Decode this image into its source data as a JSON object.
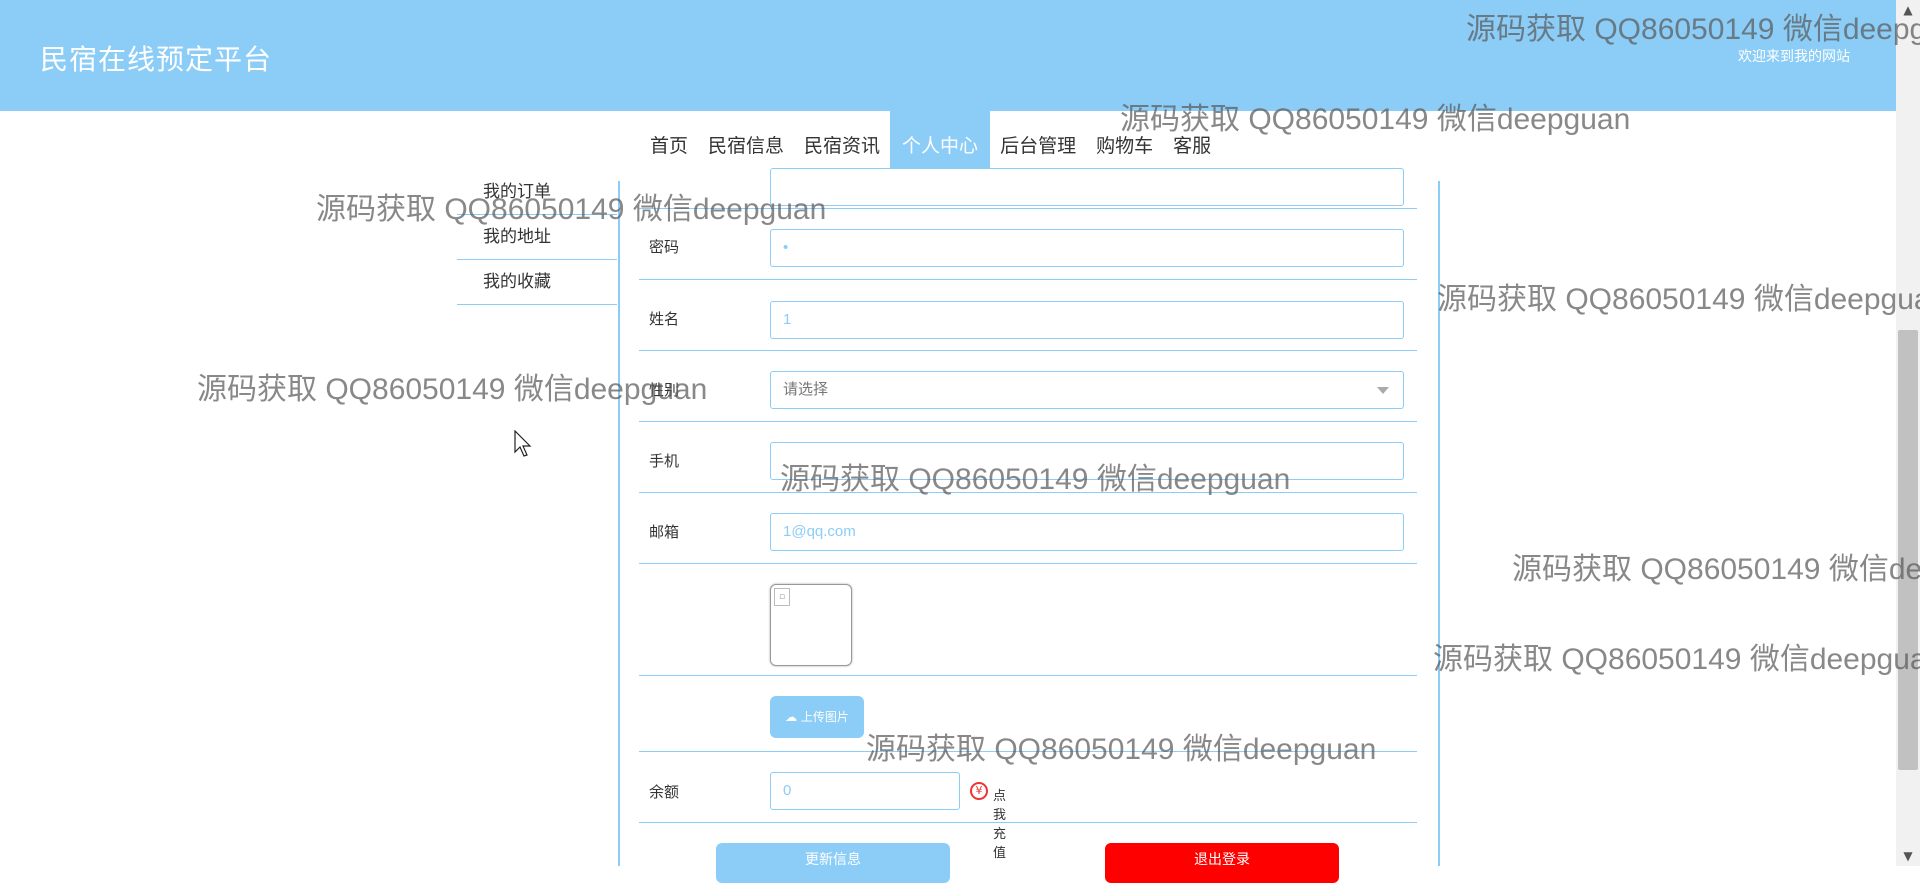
{
  "header": {
    "site_title": "民宿在线预定平台",
    "welcome": "欢迎来到我的网站",
    "bg_color": "#8bcdf7"
  },
  "nav": {
    "items": [
      "首页",
      "民宿信息",
      "民宿资讯",
      "个人中心",
      "后台管理",
      "购物车",
      "客服"
    ],
    "active": "个人中心"
  },
  "side_menu": {
    "items": [
      "我的订单",
      "我的地址",
      "我的收藏"
    ]
  },
  "form": {
    "password_label": "密码",
    "password_value": "•",
    "name_label": "姓名",
    "name_value": "1",
    "gender_label": "性别",
    "gender_placeholder": "请选择",
    "phone_label": "手机",
    "phone_value": "",
    "email_label": "邮箱",
    "email_value": "1@qq.com",
    "upload_label": "上传图片",
    "balance_label": "余额",
    "balance_value": "0",
    "recharge_icon": "¥",
    "recharge_label": "点我充值",
    "update_button": "更新信息",
    "logout_button": "退出登录"
  },
  "watermark": {
    "text": "源码获取 QQ86050149 微信deepguan"
  },
  "colors": {
    "accent": "#8bcdf7",
    "danger": "#ff0000"
  },
  "icons": {
    "upload": "cloud-upload-icon",
    "recharge": "yen-icon",
    "select": "chevron-down-icon"
  }
}
